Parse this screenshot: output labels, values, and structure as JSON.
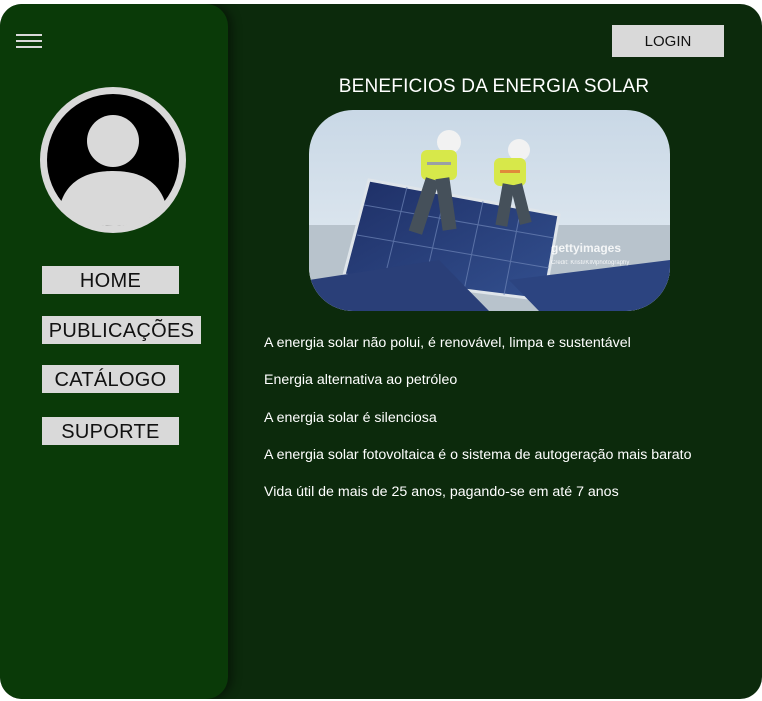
{
  "sidebar": {
    "menu_icon": "hamburger-menu-icon",
    "avatar_icon": "user-avatar-icon",
    "items": [
      {
        "label": "HOME"
      },
      {
        "label": "PUBLICAÇÕES"
      },
      {
        "label": "CATÁLOGO"
      },
      {
        "label": "SUPORTE"
      }
    ]
  },
  "header": {
    "login_label": "LOGIN"
  },
  "main": {
    "title": "BENEFICIOS DA ENERGIA SOLAR",
    "image": {
      "watermark": "gettyimages",
      "credit": "Credit: Kristi/KIMphotography"
    },
    "benefits": [
      "A energia solar não polui, é renovável, limpa e sustentável",
      "Energia alternativa ao petróleo",
      "A energia solar é silenciosa",
      "A energia solar fotovoltaica é o sistema de autogeração mais barato",
      "Vida útil de mais de 25 anos, pagando-se em até 7 anos"
    ]
  },
  "colors": {
    "background": "#0c2a0c",
    "sidebar": "#0a3a08",
    "button": "#d9d9d9",
    "text": "#ffffff"
  }
}
